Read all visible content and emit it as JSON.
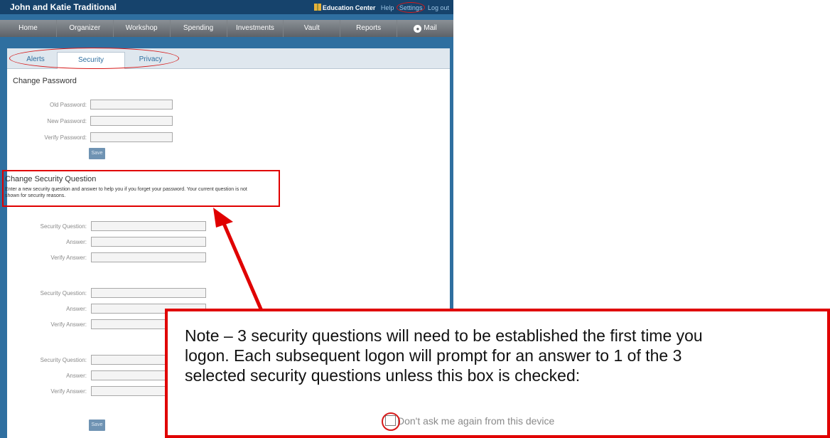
{
  "header": {
    "title": "John and Katie Traditional",
    "links": [
      "Education Center",
      "Help",
      "Settings",
      "Log out"
    ]
  },
  "nav": [
    "Home",
    "Organizer",
    "Workshop",
    "Spending",
    "Investments",
    "Vault",
    "Reports",
    "Mail"
  ],
  "tabs": [
    "Alerts",
    "Security",
    "Privacy"
  ],
  "change_password": {
    "title": "Change Password",
    "labels": [
      "Old Password:",
      "New Password:",
      "Verify Password:"
    ],
    "save": "Save"
  },
  "security_question": {
    "title": "Change Security Question",
    "description": "Enter a new security question and answer to help you if you forget your password.  Your current question is not shown for security reasons.",
    "labels": [
      "Security Question:",
      "Answer:",
      "Verify Answer:"
    ],
    "save": "Save"
  },
  "note": {
    "text": "Note – 3 security questions will need to be established the first time you logon.  Each subsequent logon will prompt for an answer to 1 of the 3 selected security questions unless this box is checked:",
    "checkbox_label": "Don't ask me again from this device"
  },
  "colors": {
    "header": "#16436c",
    "frame": "#2f6fa0",
    "highlight": "#e00000"
  }
}
